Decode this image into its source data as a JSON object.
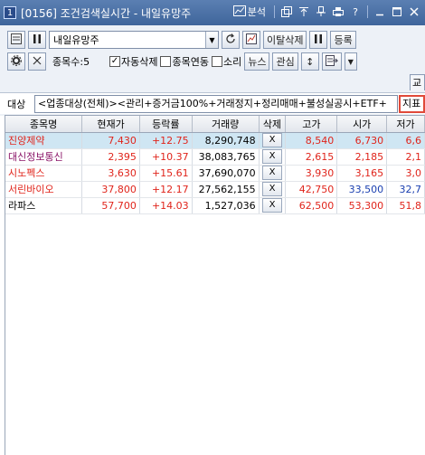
{
  "window": {
    "number": "1",
    "code": "[0156]",
    "title": "조건검색실시간 - 내일유망주",
    "analysis_label": "분석"
  },
  "toolbar": {
    "condition_name": "내일유망주",
    "exit_delete_label": "이탈삭제",
    "register_label": "등록",
    "count_label": "종목수:5",
    "auto_delete_label": "자동삭제",
    "auto_delete_checked": true,
    "stock_link_label": "종목연동",
    "stock_link_checked": false,
    "sound_label": "소리",
    "sound_checked": false,
    "news_label": "뉴스",
    "interest_label": "관심"
  },
  "tab_stub": "교",
  "condition": {
    "label": "대상",
    "text": "<업종대상(전체)><관리+증거금100%+거래정지+정리매매+불성실공시+ETF+",
    "indicator_label": "지표"
  },
  "grid": {
    "columns": [
      "종목명",
      "현재가",
      "등락률",
      "거래량",
      "삭제",
      "고가",
      "시가",
      "저가"
    ],
    "rows": [
      {
        "name": "진양제약",
        "price": "7,430",
        "rate": "+12.75",
        "volume": "8,290,748",
        "del": "X",
        "high": "8,540",
        "open": "6,730",
        "low": "6,6"
      },
      {
        "name": "대신정보통신",
        "price": "2,395",
        "rate": "+10.37",
        "volume": "38,083,765",
        "del": "X",
        "high": "2,615",
        "open": "2,185",
        "low": "2,1"
      },
      {
        "name": "시노펙스",
        "price": "3,630",
        "rate": "+15.61",
        "volume": "37,690,070",
        "del": "X",
        "high": "3,930",
        "open": "3,165",
        "low": "3,0"
      },
      {
        "name": "서린바이오",
        "price": "37,800",
        "rate": "+12.17",
        "volume": "27,562,155",
        "del": "X",
        "high": "42,750",
        "open": "33,500",
        "low": "32,7"
      },
      {
        "name": "라파스",
        "price": "57,700",
        "rate": "+14.03",
        "volume": "1,527,036",
        "del": "X",
        "high": "62,500",
        "open": "53,300",
        "low": "51,8"
      }
    ]
  },
  "colors": {
    "up": "#e0241b",
    "down": "#1a3fb0",
    "selected_row": "#cfe6f3"
  }
}
